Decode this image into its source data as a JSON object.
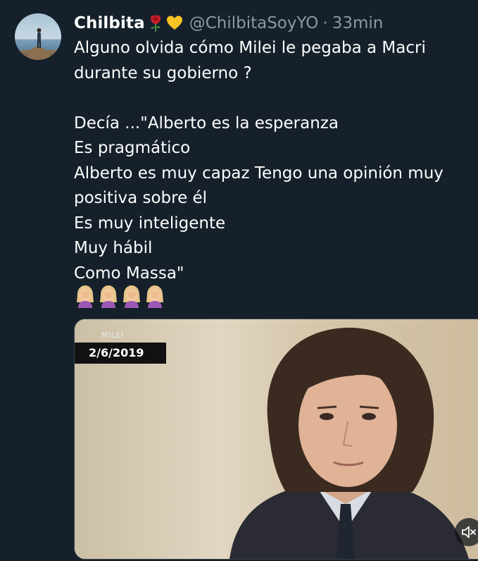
{
  "tweet": {
    "display_name": "Chilbita",
    "name_emojis": [
      "rose-emoji",
      "yellow-heart-emoji"
    ],
    "handle": "@ChilbitaSoyYO",
    "separator": "·",
    "time": "33min",
    "text": "Alguno olvida cómo Milei le pegaba a Macri\ndurante su gobierno ?\n\nDecía ...\"Alberto es la esperanza\nEs pragmático\nAlberto es muy capaz Tengo una opinión muy\npositiva sobre él\nEs muy inteligente\nMuy hábil\nComo Massa\"",
    "emoji_row": [
      "facepalm-emoji",
      "facepalm-emoji",
      "facepalm-emoji",
      "facepalm-emoji"
    ]
  },
  "media": {
    "caption": "MILEI",
    "date": "2/6/2019",
    "mute_icon": "volume-muted-icon"
  },
  "colors": {
    "background": "#15202b",
    "text": "#ffffff",
    "secondary_text": "#8b98a5"
  }
}
